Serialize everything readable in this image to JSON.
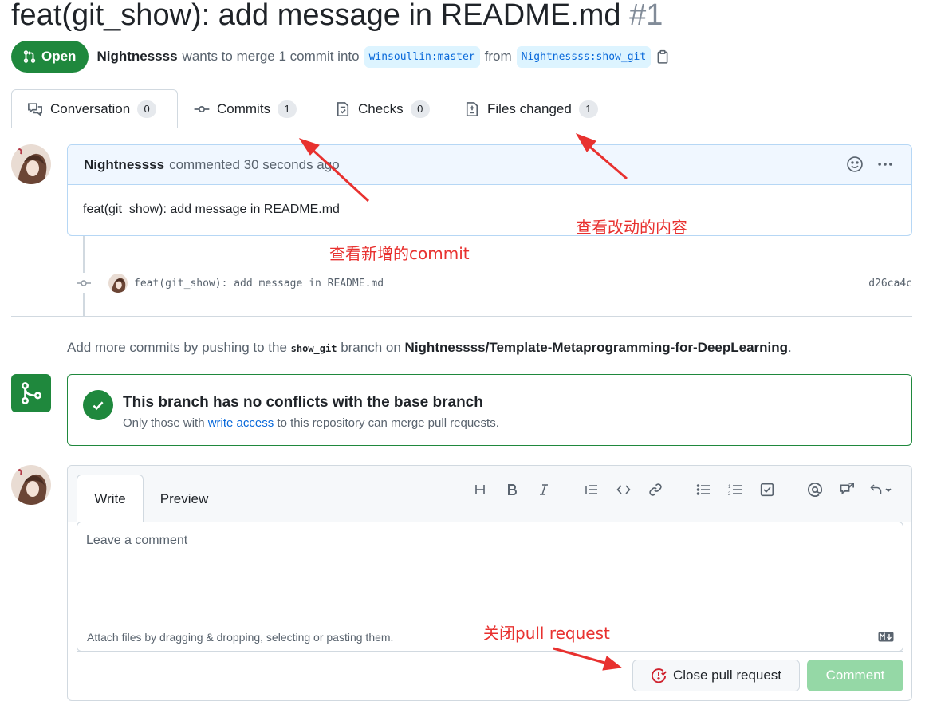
{
  "pr": {
    "title": "feat(git_show): add message in README.md",
    "number": "#1",
    "state_label": "Open",
    "author": "Nightnessss",
    "merge_text_1": "wants to merge 1 commit into",
    "base_branch": "winsoullin:master",
    "merge_text_2": "from",
    "head_branch": "Nightnessss:show_git"
  },
  "tabs": [
    {
      "label": "Conversation",
      "count": "0"
    },
    {
      "label": "Commits",
      "count": "1"
    },
    {
      "label": "Checks",
      "count": "0"
    },
    {
      "label": "Files changed",
      "count": "1"
    }
  ],
  "comment": {
    "author": "Nightnessss",
    "meta": "commented 30 seconds ago",
    "body": "feat(git_show): add message in README.md"
  },
  "commit": {
    "message": "feat(git_show): add message in README.md",
    "sha": "d26ca4c"
  },
  "push_hint": {
    "prefix": "Add more commits by pushing to the",
    "branch": "show_git",
    "middle": "branch on",
    "repo": "Nightnessss/Template-Metaprogramming-for-DeepLearning",
    "suffix": "."
  },
  "merge_status": {
    "title": "This branch has no conflicts with the base branch",
    "sub_prefix": "Only those with",
    "sub_link": "write access",
    "sub_suffix": "to this repository can merge pull requests."
  },
  "editor": {
    "tab_write": "Write",
    "tab_preview": "Preview",
    "placeholder": "Leave a comment",
    "attach_text": "Attach files by dragging & dropping, selecting or pasting them.",
    "close_button": "Close pull request",
    "comment_button": "Comment"
  },
  "annotations": {
    "commits": "查看新增的commit",
    "files": "查看改动的内容",
    "close": "关闭pull request"
  },
  "colors": {
    "accent_green": "#1f883d",
    "link_blue": "#0969da",
    "annotation_red": "#e8312f"
  }
}
